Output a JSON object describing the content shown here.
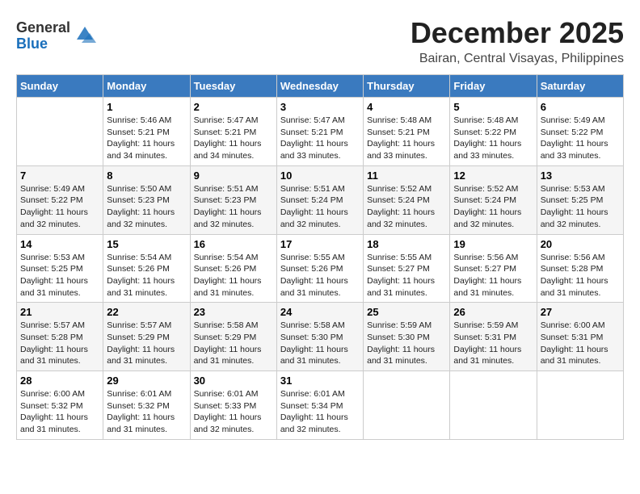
{
  "logo": {
    "general": "General",
    "blue": "Blue"
  },
  "title": "December 2025",
  "location": "Bairan, Central Visayas, Philippines",
  "headers": [
    "Sunday",
    "Monday",
    "Tuesday",
    "Wednesday",
    "Thursday",
    "Friday",
    "Saturday"
  ],
  "weeks": [
    [
      {
        "num": "",
        "info": ""
      },
      {
        "num": "1",
        "info": "Sunrise: 5:46 AM\nSunset: 5:21 PM\nDaylight: 11 hours\nand 34 minutes."
      },
      {
        "num": "2",
        "info": "Sunrise: 5:47 AM\nSunset: 5:21 PM\nDaylight: 11 hours\nand 34 minutes."
      },
      {
        "num": "3",
        "info": "Sunrise: 5:47 AM\nSunset: 5:21 PM\nDaylight: 11 hours\nand 33 minutes."
      },
      {
        "num": "4",
        "info": "Sunrise: 5:48 AM\nSunset: 5:21 PM\nDaylight: 11 hours\nand 33 minutes."
      },
      {
        "num": "5",
        "info": "Sunrise: 5:48 AM\nSunset: 5:22 PM\nDaylight: 11 hours\nand 33 minutes."
      },
      {
        "num": "6",
        "info": "Sunrise: 5:49 AM\nSunset: 5:22 PM\nDaylight: 11 hours\nand 33 minutes."
      }
    ],
    [
      {
        "num": "7",
        "info": "Sunrise: 5:49 AM\nSunset: 5:22 PM\nDaylight: 11 hours\nand 32 minutes."
      },
      {
        "num": "8",
        "info": "Sunrise: 5:50 AM\nSunset: 5:23 PM\nDaylight: 11 hours\nand 32 minutes."
      },
      {
        "num": "9",
        "info": "Sunrise: 5:51 AM\nSunset: 5:23 PM\nDaylight: 11 hours\nand 32 minutes."
      },
      {
        "num": "10",
        "info": "Sunrise: 5:51 AM\nSunset: 5:24 PM\nDaylight: 11 hours\nand 32 minutes."
      },
      {
        "num": "11",
        "info": "Sunrise: 5:52 AM\nSunset: 5:24 PM\nDaylight: 11 hours\nand 32 minutes."
      },
      {
        "num": "12",
        "info": "Sunrise: 5:52 AM\nSunset: 5:24 PM\nDaylight: 11 hours\nand 32 minutes."
      },
      {
        "num": "13",
        "info": "Sunrise: 5:53 AM\nSunset: 5:25 PM\nDaylight: 11 hours\nand 32 minutes."
      }
    ],
    [
      {
        "num": "14",
        "info": "Sunrise: 5:53 AM\nSunset: 5:25 PM\nDaylight: 11 hours\nand 31 minutes."
      },
      {
        "num": "15",
        "info": "Sunrise: 5:54 AM\nSunset: 5:26 PM\nDaylight: 11 hours\nand 31 minutes."
      },
      {
        "num": "16",
        "info": "Sunrise: 5:54 AM\nSunset: 5:26 PM\nDaylight: 11 hours\nand 31 minutes."
      },
      {
        "num": "17",
        "info": "Sunrise: 5:55 AM\nSunset: 5:26 PM\nDaylight: 11 hours\nand 31 minutes."
      },
      {
        "num": "18",
        "info": "Sunrise: 5:55 AM\nSunset: 5:27 PM\nDaylight: 11 hours\nand 31 minutes."
      },
      {
        "num": "19",
        "info": "Sunrise: 5:56 AM\nSunset: 5:27 PM\nDaylight: 11 hours\nand 31 minutes."
      },
      {
        "num": "20",
        "info": "Sunrise: 5:56 AM\nSunset: 5:28 PM\nDaylight: 11 hours\nand 31 minutes."
      }
    ],
    [
      {
        "num": "21",
        "info": "Sunrise: 5:57 AM\nSunset: 5:28 PM\nDaylight: 11 hours\nand 31 minutes."
      },
      {
        "num": "22",
        "info": "Sunrise: 5:57 AM\nSunset: 5:29 PM\nDaylight: 11 hours\nand 31 minutes."
      },
      {
        "num": "23",
        "info": "Sunrise: 5:58 AM\nSunset: 5:29 PM\nDaylight: 11 hours\nand 31 minutes."
      },
      {
        "num": "24",
        "info": "Sunrise: 5:58 AM\nSunset: 5:30 PM\nDaylight: 11 hours\nand 31 minutes."
      },
      {
        "num": "25",
        "info": "Sunrise: 5:59 AM\nSunset: 5:30 PM\nDaylight: 11 hours\nand 31 minutes."
      },
      {
        "num": "26",
        "info": "Sunrise: 5:59 AM\nSunset: 5:31 PM\nDaylight: 11 hours\nand 31 minutes."
      },
      {
        "num": "27",
        "info": "Sunrise: 6:00 AM\nSunset: 5:31 PM\nDaylight: 11 hours\nand 31 minutes."
      }
    ],
    [
      {
        "num": "28",
        "info": "Sunrise: 6:00 AM\nSunset: 5:32 PM\nDaylight: 11 hours\nand 31 minutes."
      },
      {
        "num": "29",
        "info": "Sunrise: 6:01 AM\nSunset: 5:32 PM\nDaylight: 11 hours\nand 31 minutes."
      },
      {
        "num": "30",
        "info": "Sunrise: 6:01 AM\nSunset: 5:33 PM\nDaylight: 11 hours\nand 32 minutes."
      },
      {
        "num": "31",
        "info": "Sunrise: 6:01 AM\nSunset: 5:34 PM\nDaylight: 11 hours\nand 32 minutes."
      },
      {
        "num": "",
        "info": ""
      },
      {
        "num": "",
        "info": ""
      },
      {
        "num": "",
        "info": ""
      }
    ]
  ]
}
